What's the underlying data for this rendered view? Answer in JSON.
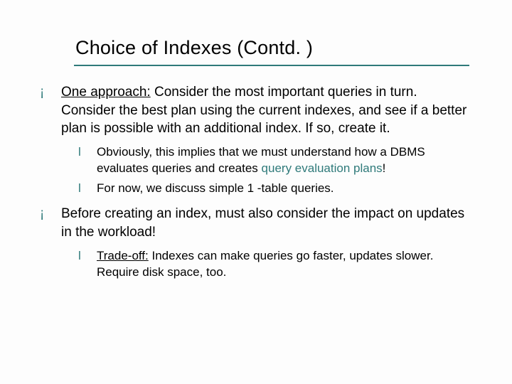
{
  "title": "Choice of Indexes (Contd. )",
  "bullets": [
    {
      "level": 1,
      "prefix_underlined": "One approach:",
      "rest": " Consider the most important queries in turn.  Consider the best plan using the current indexes, and see if a better plan is possible with an additional index.  If so, create it."
    },
    {
      "level": 2,
      "plain_before": "Obviously, this implies that we must understand how a DBMS evaluates queries and creates ",
      "teal_span": "query evaluation plans",
      "plain_after": "!"
    },
    {
      "level": 2,
      "plain": "For now, we discuss simple 1 -table queries."
    },
    {
      "level": 1,
      "plain": "Before creating an index, must also consider the impact on updates in the workload!"
    },
    {
      "level": 2,
      "teal_underlined": "Trade-off:",
      "teal_rest": " Indexes can make queries go faster, updates slower.  Require disk space, too."
    }
  ],
  "markers": {
    "l1": "¡",
    "l2": "l"
  }
}
